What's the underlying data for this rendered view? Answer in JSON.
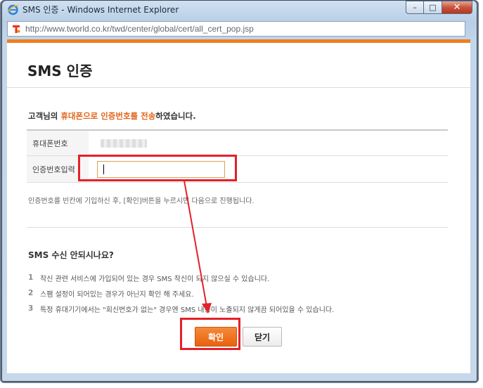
{
  "window": {
    "title": "SMS 인증 - Windows Internet Explorer",
    "address": "http://www.tworld.co.kr/twd/center/global/cert/all_cert_pop.jsp",
    "minimize": "–",
    "maximize": "□",
    "close": "✕"
  },
  "popup": {
    "title": "SMS 인증",
    "notice": {
      "prefix": "고객님의 ",
      "highlight": "휴대폰으로 인증번호를 전송",
      "suffix": "하였습니다."
    },
    "fields": {
      "phone_label": "휴대폰번호",
      "code_label": "인증번호입력",
      "code_value": ""
    },
    "hint": "인증번호를 빈칸에 기입하신 후, [확인]버튼을 누르시면 다음으로 진행됩니다.",
    "faq_title": "SMS 수신 안되시나요?",
    "tips": [
      {
        "num": "1",
        "text": "착신 관련 서비스에 가입되어 있는 경우 SMS 착신이 되지 않으실 수 있습니다."
      },
      {
        "num": "2",
        "text": "스팸 설정이 되어있는 경우가 아닌지 확인 해 주세요."
      },
      {
        "num": "3",
        "text": "특정 휴대기기에서는 \"회신번호가 없는\" 경우엔 SMS 내용이 노출되지 않게끔 되어있을 수 있습니다."
      }
    ],
    "buttons": {
      "confirm": "확인",
      "close": "닫기"
    }
  },
  "colors": {
    "accent": "#f07e1f",
    "highlight_text": "#e2651b",
    "annotation": "#e4202a"
  }
}
